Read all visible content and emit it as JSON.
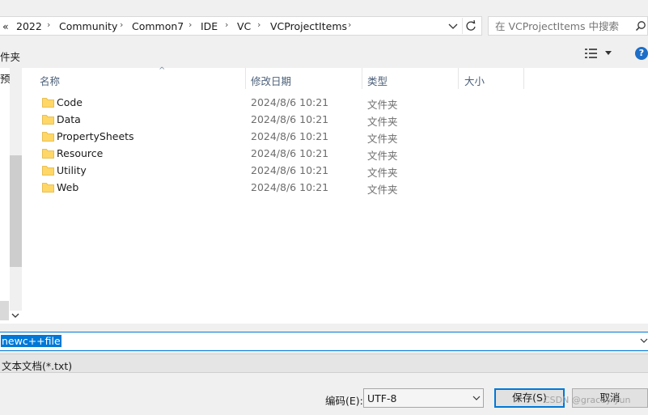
{
  "address_bar": {
    "overflow": "«",
    "crumbs": [
      "2022",
      "Community",
      "Common7",
      "IDE",
      "VC",
      "VCProjectItems"
    ]
  },
  "search": {
    "placeholder": "在 VCProjectItems 中搜索"
  },
  "toolbar": {
    "new_folder_fragment": "件夹"
  },
  "nav": {
    "label_fragment": "预"
  },
  "columns": {
    "name": "名称",
    "date": "修改日期",
    "type": "类型",
    "size": "大小"
  },
  "files": [
    {
      "name": "Code",
      "date": "2024/8/6 10:21",
      "type": "文件夹"
    },
    {
      "name": "Data",
      "date": "2024/8/6 10:21",
      "type": "文件夹"
    },
    {
      "name": "PropertySheets",
      "date": "2024/8/6 10:21",
      "type": "文件夹"
    },
    {
      "name": "Resource",
      "date": "2024/8/6 10:21",
      "type": "文件夹"
    },
    {
      "name": "Utility",
      "date": "2024/8/6 10:21",
      "type": "文件夹"
    },
    {
      "name": "Web",
      "date": "2024/8/6 10:21",
      "type": "文件夹"
    }
  ],
  "filename": {
    "value": "newc++file"
  },
  "filetype": {
    "value": "文本文档(*.txt)"
  },
  "encoding": {
    "label": "编码(E):",
    "value": "UTF-8"
  },
  "buttons": {
    "save": "保存(S)",
    "cancel": "取消"
  },
  "watermark": "CSDN @gracey-yun",
  "colors": {
    "accent": "#0078d7",
    "folder": "#ffd767",
    "header_text": "#4c607a"
  }
}
